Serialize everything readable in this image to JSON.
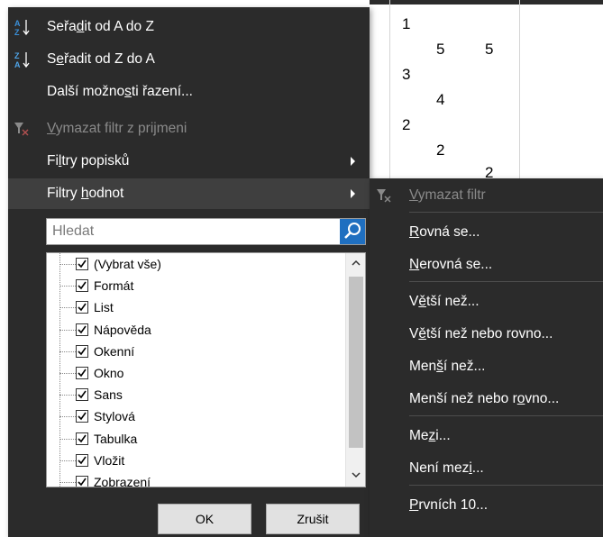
{
  "sheet": {
    "cells": [
      "1",
      "5",
      "5",
      "3",
      "4",
      "2",
      "2",
      "2"
    ]
  },
  "menu": {
    "sort_asc": {
      "pre": "Seřa",
      "u": "d",
      "post": "it od A do Z",
      "icon": "sort-ascending-icon"
    },
    "sort_desc": {
      "pre": "S",
      "u": "e",
      "post": "řadit od Z do A",
      "icon": "sort-descending-icon"
    },
    "more_sort": {
      "pre": "Další možno",
      "u": "s",
      "post": "ti řazení..."
    },
    "clear_filter": {
      "pre": "",
      "u": "V",
      "post": "ymazat filtr z prijmeni",
      "icon": "clear-filter-icon"
    },
    "label_filters": {
      "pre": "Fi",
      "u": "l",
      "post": "try popisků"
    },
    "value_filters": {
      "pre": "Filtry ",
      "u": "h",
      "post": "odnot"
    },
    "search": {
      "placeholder": "Hledat",
      "icon": "search-icon"
    },
    "checklist": [
      {
        "label": "(Vybrat vše)",
        "checked": true
      },
      {
        "label": "Formát",
        "checked": true
      },
      {
        "label": "List",
        "checked": true
      },
      {
        "label": "Nápověda",
        "checked": true
      },
      {
        "label": "Okenní",
        "checked": true
      },
      {
        "label": "Okno",
        "checked": true
      },
      {
        "label": "Sans",
        "checked": true
      },
      {
        "label": "Stylová",
        "checked": true
      },
      {
        "label": "Tabulka",
        "checked": true
      },
      {
        "label": "Vložit",
        "checked": true
      },
      {
        "label": "Zobrazení",
        "checked": true
      }
    ],
    "ok_label": "OK",
    "cancel_label": "Zrušit"
  },
  "submenu": {
    "clear": {
      "pre": "",
      "u": "V",
      "post": "ymazat filtr",
      "icon": "clear-filter-icon"
    },
    "items": [
      {
        "pre": "",
        "u": "R",
        "post": "ovná se..."
      },
      {
        "pre": "",
        "u": "N",
        "post": "erovná se..."
      },
      {
        "pre": "V",
        "u": "ě",
        "post": "tší než..."
      },
      {
        "pre": "V",
        "u": "ě",
        "post": "tší než nebo rovno..."
      },
      {
        "pre": "Men",
        "u": "š",
        "post": "í než..."
      },
      {
        "pre": "Menší než nebo r",
        "u": "o",
        "post": "vno..."
      },
      {
        "pre": "Me",
        "u": "z",
        "post": "i..."
      },
      {
        "pre": "Není mez",
        "u": "i",
        "post": "..."
      },
      {
        "pre": "",
        "u": "P",
        "post": "rvních 10..."
      }
    ]
  },
  "colors": {
    "menu_bg": "#2b2b2b",
    "menu_active": "#3f3f3f",
    "menu_disabled_text": "#8a8a8a",
    "search_button": "#1f6fc0",
    "sort_a_blue": "#3a8fd8",
    "sort_z_blue": "#4fa3e6"
  }
}
